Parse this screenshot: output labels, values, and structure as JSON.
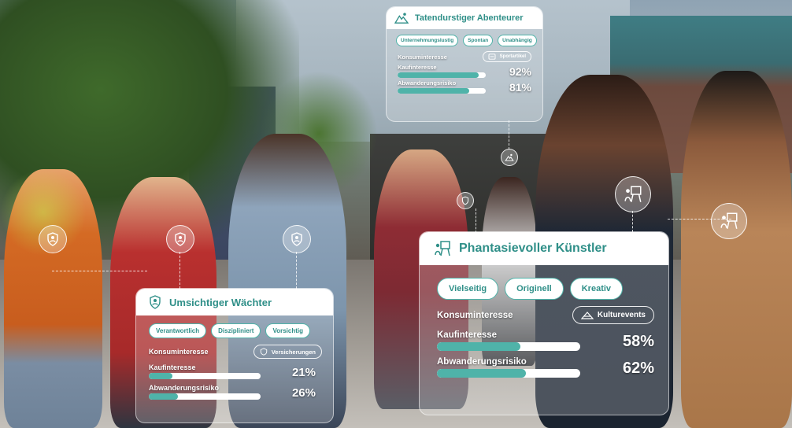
{
  "colors": {
    "accent": "#2f8f88",
    "tag_border": "#4fb3a9",
    "bar_fill": "#4fb3a9",
    "bar_track": "#ffffff"
  },
  "markers": [
    {
      "icon": "shield-person-icon"
    },
    {
      "icon": "shield-person-icon"
    },
    {
      "icon": "shield-person-icon"
    },
    {
      "icon": "mountain-person-icon"
    },
    {
      "icon": "shield-person-icon"
    },
    {
      "icon": "artist-easel-icon"
    },
    {
      "icon": "artist-easel-icon"
    }
  ],
  "cards": {
    "adventurer": {
      "icon": "mountain-person-icon",
      "title": "Tatendurstiger Abenteurer",
      "tags": [
        "Unternehmungslustig",
        "Spontan",
        "Unabhängig"
      ],
      "consumer_interest_label": "Konsuminteresse",
      "consumer_interest_value": "Sportartikel",
      "consumer_interest_icon": "sports-icon",
      "purchase_label": "Kaufinteresse",
      "purchase_value": "92%",
      "purchase_fraction": 0.92,
      "churn_label": "Abwanderungsrisiko",
      "churn_value": "81%",
      "churn_fraction": 0.81
    },
    "artist": {
      "icon": "artist-easel-icon",
      "title": "Phantasievoller Künstler",
      "tags": [
        "Vielseitig",
        "Originell",
        "Kreativ"
      ],
      "consumer_interest_label": "Konsuminteresse",
      "consumer_interest_value": "Kulturevents",
      "consumer_interest_icon": "culture-icon",
      "purchase_label": "Kaufinteresse",
      "purchase_value": "58%",
      "purchase_fraction": 0.58,
      "churn_label": "Abwanderungsrisiko",
      "churn_value": "62%",
      "churn_fraction": 0.62
    },
    "guardian": {
      "icon": "shield-person-icon",
      "title": "Umsichtiger Wächter",
      "tags": [
        "Verantwortlich",
        "Diszipliniert",
        "Vorsichtig"
      ],
      "consumer_interest_label": "Konsuminteresse",
      "consumer_interest_value": "Versicherungen",
      "consumer_interest_icon": "insurance-icon",
      "purchase_label": "Kaufinteresse",
      "purchase_value": "21%",
      "purchase_fraction": 0.21,
      "churn_label": "Abwanderungsrisiko",
      "churn_value": "26%",
      "churn_fraction": 0.26
    }
  }
}
